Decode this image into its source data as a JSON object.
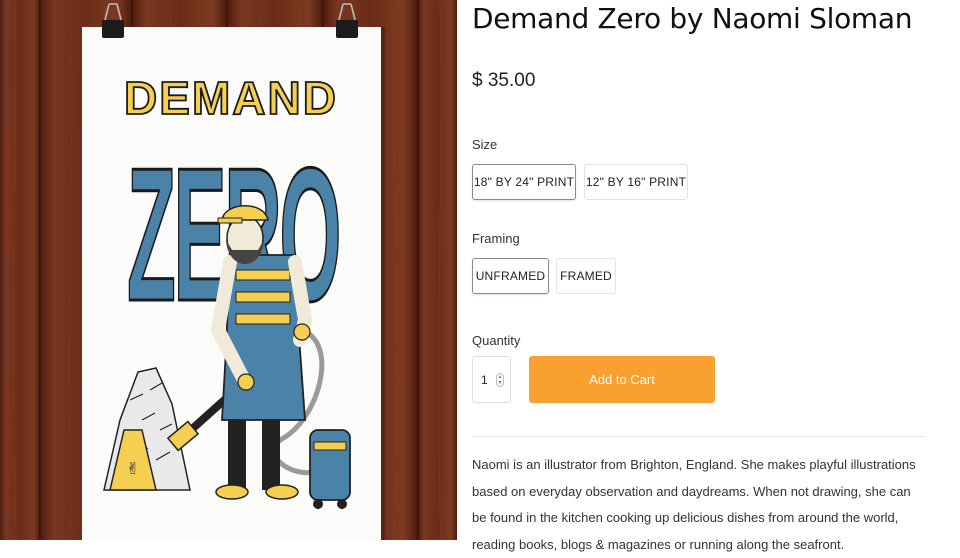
{
  "product": {
    "title": "Demand Zero by Naomi Sloman",
    "price": "$ 35.00",
    "image": {
      "poster_text_top": "DEMAND",
      "poster_text_main": "ZERO",
      "colors": {
        "wood": "#6e2f1c",
        "poster_blue": "#4a82a8",
        "poster_yellow": "#f4cf52"
      }
    }
  },
  "options": {
    "size": {
      "label": "Size",
      "choices": [
        "18\" BY 24\" PRINT",
        "12\" BY 16\" PRINT"
      ],
      "selected": "18\" BY 24\" PRINT"
    },
    "framing": {
      "label": "Framing",
      "choices": [
        "UNFRAMED",
        "FRAMED"
      ],
      "selected": "UNFRAMED"
    }
  },
  "quantity": {
    "label": "Quantity",
    "value": "1",
    "spinner_icon": "up-down-stepper"
  },
  "cart": {
    "add_label": "Add to Cart",
    "button_color": "#f8a030"
  },
  "description": "Naomi is an illustrator from Brighton, England. She makes playful illustrations based on everyday observation and daydreams. When not drawing, she can be found in the kitchen cooking up delicious dishes from around the world, reading books, blogs & magazines or running along the seafront."
}
